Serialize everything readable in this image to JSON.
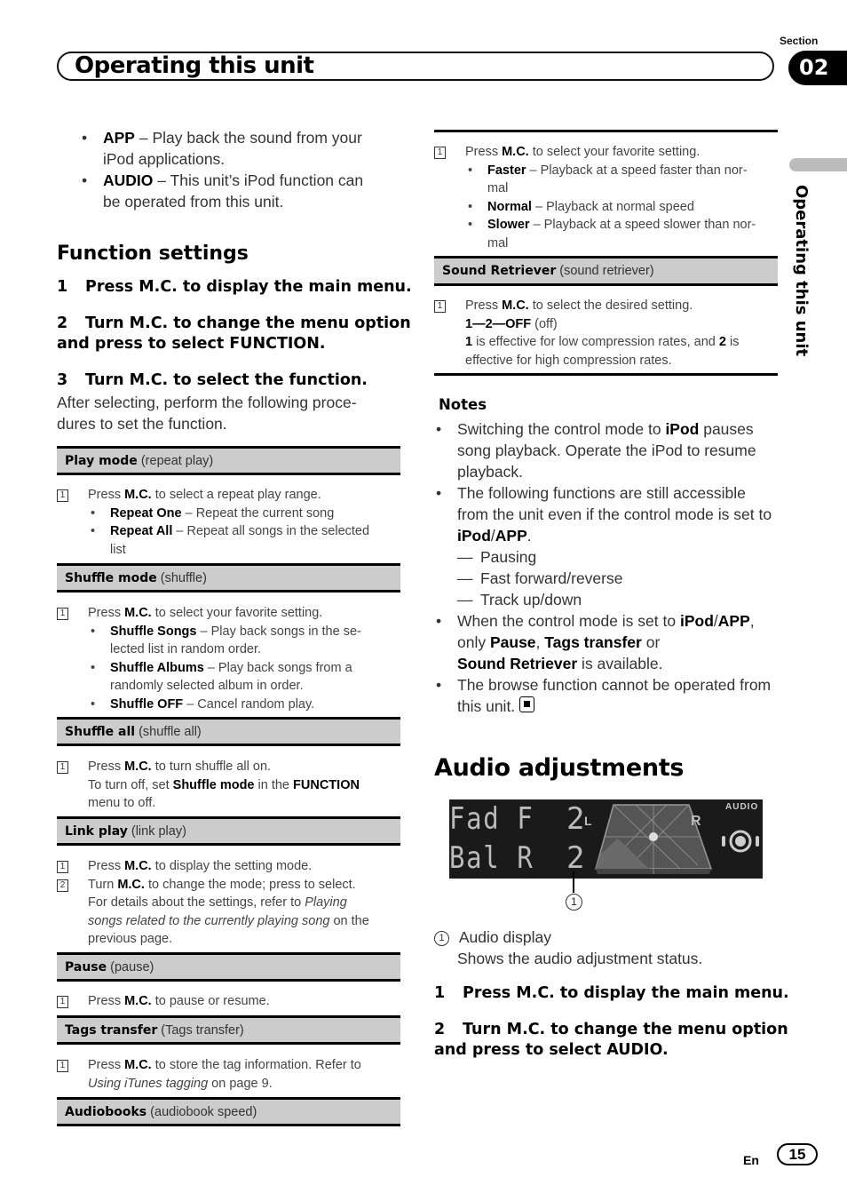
{
  "header": {
    "section_label": "Section",
    "section_number": "02",
    "title": "Operating this unit",
    "side_label": "Operating this unit"
  },
  "left": {
    "intro_bullets": [
      {
        "term": "APP",
        "text": " – Play back the sound from your",
        "text2": "iPod applications."
      },
      {
        "term": "AUDIO",
        "text": " – This unit’s iPod function can",
        "text2": "be operated from this unit."
      }
    ],
    "heading": "Function settings",
    "steps": [
      {
        "num": "1",
        "text": "Press M.C. to display the main menu."
      },
      {
        "num": "2",
        "text": "Turn M.C. to change the menu option",
        "text2": "and press to select FUNCTION."
      },
      {
        "num": "3",
        "text": "Turn M.C. to select the function."
      }
    ],
    "after_text": "After selecting, perform the following proce-",
    "after_text2": "dures to set the function.",
    "tables": {
      "play_mode": {
        "name": "Play mode",
        "sub": " (repeat play)",
        "step_num": "1",
        "pre": "Press ",
        "mc": "M.C.",
        "post": " to select a repeat play range.",
        "options": [
          {
            "term": "Repeat One",
            "text": " – Repeat the current song"
          },
          {
            "term": "Repeat All",
            "text": " – Repeat all songs in the selected",
            "text2": "list"
          }
        ]
      },
      "shuffle_mode": {
        "name": "Shuffle mode",
        "sub": " (shuffle)",
        "step_num": "1",
        "pre": "Press ",
        "mc": "M.C.",
        "post": " to select your favorite setting.",
        "options": [
          {
            "term": "Shuffle Songs",
            "text": " – Play back songs in the se-",
            "text2": "lected list in random order."
          },
          {
            "term": "Shuffle Albums",
            "text": " – Play back songs from a",
            "text2": "randomly selected album in order."
          },
          {
            "term": "Shuffle OFF",
            "text": " – Cancel random play."
          }
        ]
      },
      "shuffle_all": {
        "name": "Shuffle all",
        "sub": " (shuffle all)",
        "step_num": "1",
        "pre": "Press ",
        "mc": "M.C.",
        "post": " to turn shuffle all on.",
        "line2_pre": "To turn off, set ",
        "line2_b1": "Shuffle mode",
        "line2_mid": " in the ",
        "line2_b2": "FUNCTION",
        "line3": "menu to off."
      },
      "link_play": {
        "name": "Link play",
        "sub": " (link play)",
        "step1_num": "1",
        "step1_pre": "Press ",
        "step1_mc": "M.C.",
        "step1_post": " to display the setting mode.",
        "step2_num": "2",
        "step2_pre": "Turn ",
        "step2_mc": "M.C.",
        "step2_post": " to change the mode; press to select.",
        "ref_pre": "For details about the settings, refer to ",
        "ref_it1": "Playing",
        "ref_it2": "songs related to the currently playing song",
        "ref_post": " on the",
        "ref_line4": "previous page."
      },
      "pause": {
        "name": "Pause",
        "sub": " (pause)",
        "step_num": "1",
        "pre": "Press ",
        "mc": "M.C.",
        "post": " to pause or resume."
      },
      "tags_transfer": {
        "name": "Tags transfer",
        "sub": " (Tags transfer)",
        "step_num": "1",
        "pre": "Press ",
        "mc": "M.C.",
        "post": " to store the tag information. Refer to",
        "ref_it": "Using iTunes tagging",
        "ref_post": " on page 9."
      },
      "audiobooks": {
        "name": "Audiobooks",
        "sub": " (audiobook speed)"
      }
    }
  },
  "right": {
    "audiobooks_body": {
      "step_num": "1",
      "pre": "Press ",
      "mc": "M.C.",
      "post": " to select your favorite setting.",
      "options": [
        {
          "term": "Faster",
          "text": " – Playback at a speed faster than nor-",
          "text2": "mal"
        },
        {
          "term": "Normal",
          "text": " – Playback at normal speed"
        },
        {
          "term": "Slower",
          "text": " – Playback at a speed slower than nor-",
          "text2": "mal"
        }
      ]
    },
    "sound_retriever": {
      "name": "Sound Retriever",
      "sub": " (sound retriever)",
      "step_num": "1",
      "pre": "Press ",
      "mc": "M.C.",
      "post": " to select the desired setting.",
      "seq_b": "1—2—OFF",
      "seq_post": " (off)",
      "line3_b1": "1",
      "line3_mid": " is effective for low compression rates, and ",
      "line3_b2": "2",
      "line3_post": " is",
      "line4": "effective for high compression rates."
    },
    "notes": {
      "title": "Notes",
      "n1_pre": "Switching the control mode to ",
      "n1_b": "iPod",
      "n1_post": " pauses",
      "n1_l2": "song playback. Operate the iPod to resume",
      "n1_l3": "playback.",
      "n2_l1": "The following functions are still accessible",
      "n2_l2": "from the unit even if the control mode is set to",
      "n2_b1": "iPod",
      "n2_slash": "/",
      "n2_b2": "APP",
      "n2_dot": ".",
      "dash_items": [
        "Pausing",
        "Fast forward/reverse",
        "Track up/down"
      ],
      "n3_pre": "When the control mode is set to ",
      "n3_b1": "iPod",
      "n3_slash": "/",
      "n3_b2": "APP",
      "n3_comma": ",",
      "n3_l2_pre": "only ",
      "n3_l2_b1": "Pause",
      "n3_l2_c": ", ",
      "n3_l2_b2": "Tags transfer",
      "n3_l2_post": " or",
      "n3_l3_b": "Sound Retriever",
      "n3_l3_post": " is available.",
      "n4_l1": "The browse function cannot be operated from",
      "n4_l2": "this unit."
    },
    "audio_heading": "Audio adjustments",
    "lcd": {
      "row1_label": "Fad F",
      "row1_value": "2",
      "row2_label": "Bal R",
      "row2_value": "2",
      "mode_label": "AUDIO",
      "left_marker": "L",
      "right_marker": "R"
    },
    "callout_num": "1",
    "legend": {
      "num": "1",
      "title": "Audio display",
      "desc": "Shows the audio adjustment status."
    },
    "steps": [
      {
        "num": "1",
        "text": "Press M.C. to display the main menu."
      },
      {
        "num": "2",
        "text": "Turn M.C. to change the menu option",
        "text2": "and press to select AUDIO."
      }
    ]
  },
  "footer": {
    "lang": "En",
    "page": "15"
  }
}
